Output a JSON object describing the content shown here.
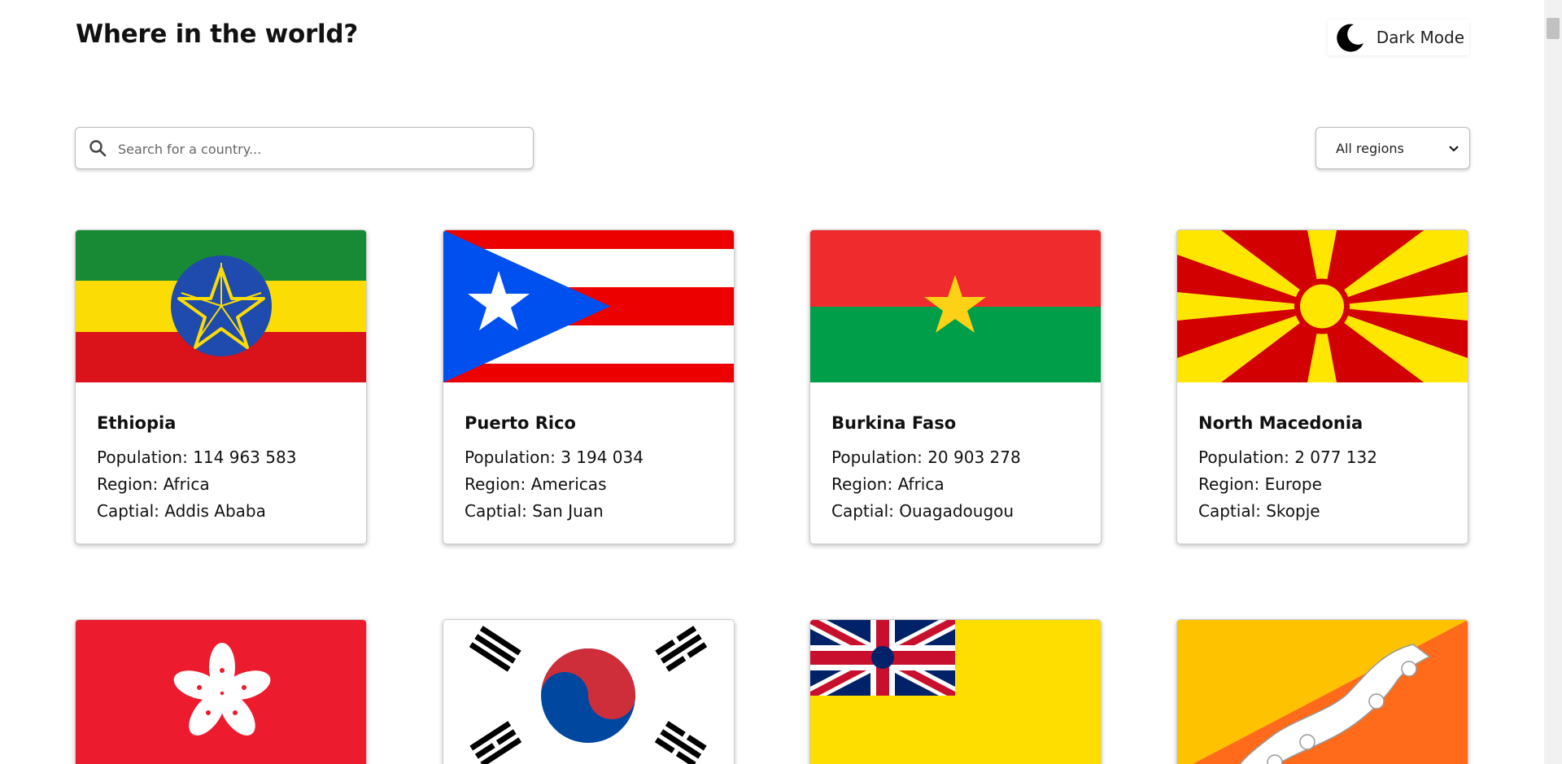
{
  "header": {
    "title": "Where in the world?",
    "dark_mode_label": "Dark Mode",
    "dark_mode_icon": "moon-icon"
  },
  "search": {
    "placeholder": "Search for a country...",
    "value": "",
    "icon": "search-icon"
  },
  "filter": {
    "selected": "All regions",
    "icon": "chevron-down-icon"
  },
  "labels": {
    "population": "Population: ",
    "region": "Region: ",
    "capital": "Captial: "
  },
  "countries": [
    {
      "name": "Ethiopia",
      "population": "114 963 583",
      "region": "Africa",
      "capital": "Addis Ababa",
      "flag": "ethiopia-flag"
    },
    {
      "name": "Puerto Rico",
      "population": "3 194 034",
      "region": "Americas",
      "capital": "San Juan",
      "flag": "puerto-rico-flag"
    },
    {
      "name": "Burkina Faso",
      "population": "20 903 278",
      "region": "Africa",
      "capital": "Ouagadougou",
      "flag": "burkina-faso-flag"
    },
    {
      "name": "North Macedonia",
      "population": "2 077 132",
      "region": "Europe",
      "capital": "Skopje",
      "flag": "north-macedonia-flag"
    }
  ],
  "partial_cards": [
    {
      "flag": "hong-kong-flag"
    },
    {
      "flag": "south-korea-flag"
    },
    {
      "flag": "niue-flag"
    },
    {
      "flag": "bhutan-flag"
    }
  ],
  "colors": {
    "background": "#ffffff",
    "text": "#111111",
    "border": "#cccccc"
  }
}
